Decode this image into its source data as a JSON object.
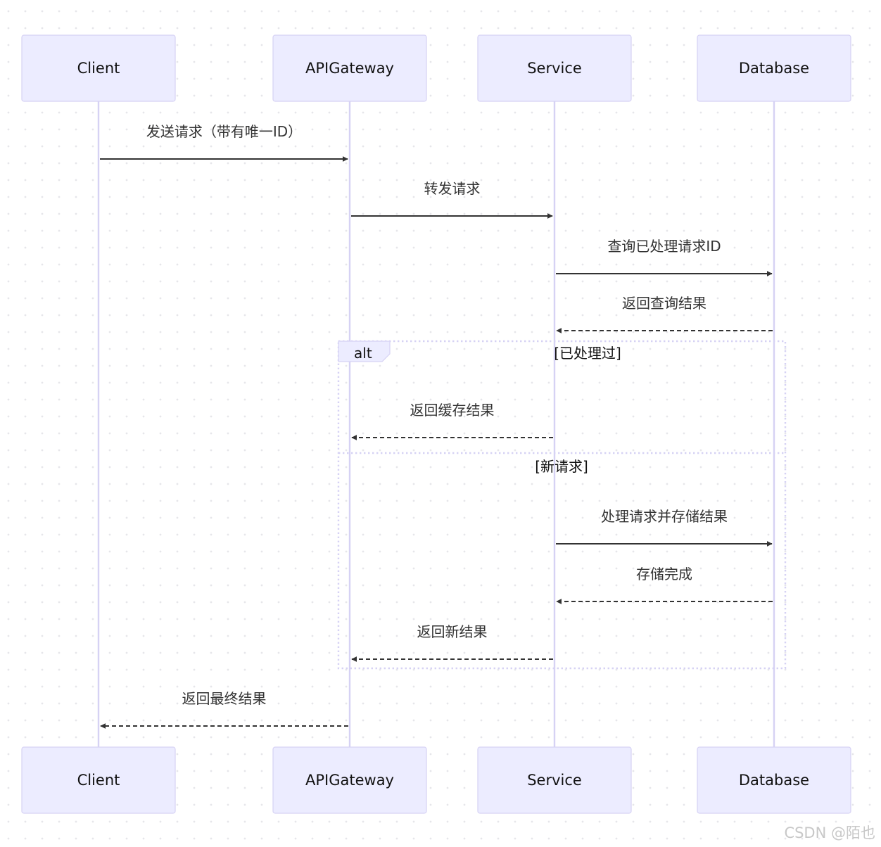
{
  "diagram": {
    "type": "sequence",
    "participants": [
      {
        "id": "client",
        "label": "Client"
      },
      {
        "id": "gateway",
        "label": "APIGateway"
      },
      {
        "id": "service",
        "label": "Service"
      },
      {
        "id": "database",
        "label": "Database"
      }
    ],
    "messages": [
      {
        "from": "client",
        "to": "gateway",
        "text": "发送请求（带有唯一ID）",
        "style": "solid"
      },
      {
        "from": "gateway",
        "to": "service",
        "text": "转发请求",
        "style": "solid"
      },
      {
        "from": "service",
        "to": "database",
        "text": "查询已处理请求ID",
        "style": "solid"
      },
      {
        "from": "database",
        "to": "service",
        "text": "返回查询结果",
        "style": "dashed"
      },
      {
        "from": "service",
        "to": "gateway",
        "text": "返回缓存结果",
        "style": "dashed",
        "block": "alt-branch-1"
      },
      {
        "from": "service",
        "to": "database",
        "text": "处理请求并存储结果",
        "style": "solid",
        "block": "alt-branch-2"
      },
      {
        "from": "database",
        "to": "service",
        "text": "存储完成",
        "style": "dashed",
        "block": "alt-branch-2"
      },
      {
        "from": "service",
        "to": "gateway",
        "text": "返回新结果",
        "style": "dashed",
        "block": "alt-branch-2"
      },
      {
        "from": "gateway",
        "to": "client",
        "text": "返回最终结果",
        "style": "dashed"
      }
    ],
    "alt_block": {
      "label": "alt",
      "branches": [
        {
          "condition": "[已处理过]"
        },
        {
          "condition": "[新请求]"
        }
      ]
    }
  },
  "watermark": "CSDN @陌也"
}
